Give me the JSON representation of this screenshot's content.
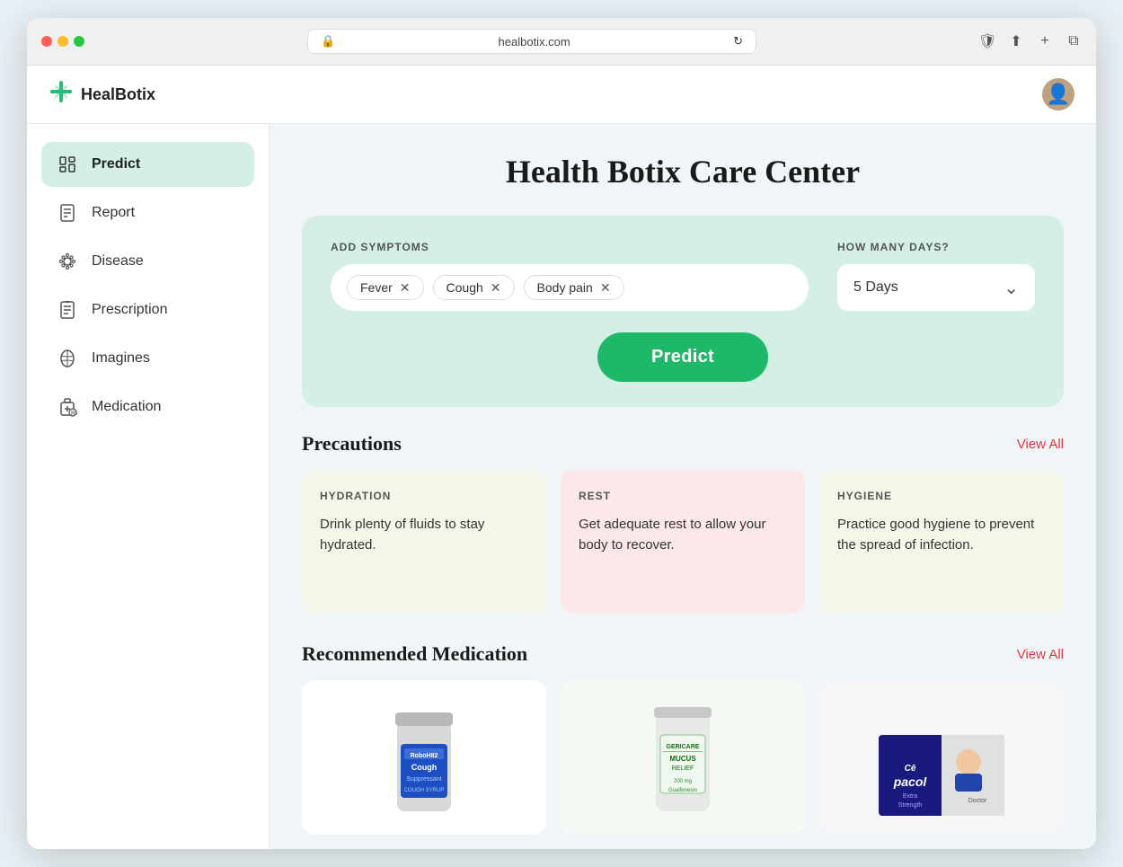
{
  "browser": {
    "url": "healbotix.com",
    "reload_icon": "↻",
    "shield_icon": "🛡",
    "share_icon": "⬆",
    "new_tab_icon": "+",
    "tabs_icon": "⧉"
  },
  "logo": {
    "name": "HealBotix",
    "icon": "✚"
  },
  "sidebar": {
    "items": [
      {
        "id": "predict",
        "label": "Predict",
        "active": true
      },
      {
        "id": "report",
        "label": "Report",
        "active": false
      },
      {
        "id": "disease",
        "label": "Disease",
        "active": false
      },
      {
        "id": "prescription",
        "label": "Prescription",
        "active": false
      },
      {
        "id": "imagines",
        "label": "Imagines",
        "active": false
      },
      {
        "id": "medication",
        "label": "Medication",
        "active": false
      }
    ]
  },
  "main": {
    "page_title": "Health Botix Care Center",
    "symptom_section": {
      "add_symptoms_label": "ADD SYMPTOMS",
      "how_many_days_label": "HOW MANY DAYS?",
      "symptoms": [
        {
          "id": "fever",
          "label": "Fever"
        },
        {
          "id": "cough",
          "label": "Cough"
        },
        {
          "id": "body_pain",
          "label": "Body pain"
        }
      ],
      "days_value": "5 Days",
      "predict_button_label": "Predict"
    },
    "precautions": {
      "section_title": "Precautions",
      "view_all_label": "View All",
      "cards": [
        {
          "id": "hydration",
          "label": "HYDRATION",
          "text": "Drink plenty of fluids to stay hydrated.",
          "bg_class": "hydration"
        },
        {
          "id": "rest",
          "label": "REST",
          "text": "Get adequate rest to allow your body to recover.",
          "bg_class": "rest"
        },
        {
          "id": "hygiene",
          "label": "HYGIENE",
          "text": "Practice good hygiene to prevent the spread of infection.",
          "bg_class": "hygiene"
        }
      ]
    },
    "recommended_medication": {
      "section_title": "Recommended Medication",
      "view_all_label": "View All",
      "items": [
        {
          "id": "cough_suppressant",
          "name": "RoboH82 Cough Suppressant"
        },
        {
          "id": "mucus_relief",
          "name": "Geridcare Mucus Relief"
        },
        {
          "id": "cepacol",
          "name": "Cepacol Extra Strength"
        }
      ]
    }
  }
}
